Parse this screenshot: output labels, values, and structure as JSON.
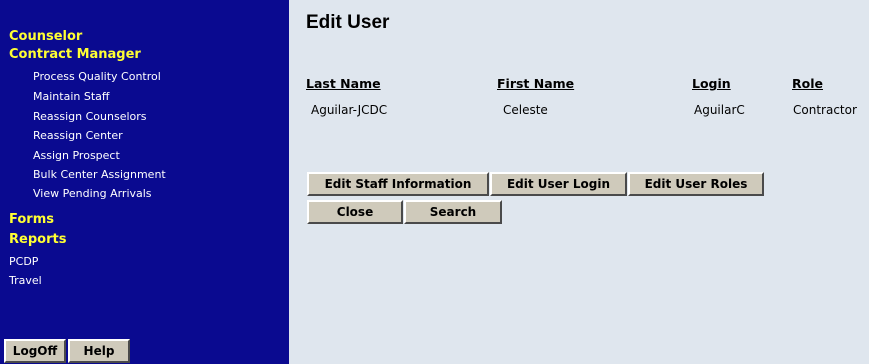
{
  "sidebar": {
    "sections": {
      "counselor": "Counselor",
      "contract_manager": "Contract Manager",
      "forms": "Forms",
      "reports": "Reports"
    },
    "contract_items": [
      "Process Quality Control",
      "Maintain Staff",
      "Reassign Counselors",
      "Reassign Center",
      "Assign Prospect",
      "Bulk Center Assignment",
      "View Pending Arrivals"
    ],
    "links": {
      "pcdp": "PCDP",
      "travel": "Travel"
    },
    "buttons": {
      "logoff": "LogOff",
      "help": "Help"
    }
  },
  "main": {
    "title": "Edit User",
    "columns": {
      "last_name": "Last Name",
      "first_name": "First Name",
      "login": "Login",
      "role": "Role"
    },
    "user": {
      "last_name": "Aguilar-JCDC",
      "first_name": "Celeste",
      "login": "AguilarC",
      "role": "Contractor"
    },
    "buttons": {
      "edit_staff": "Edit Staff Information",
      "edit_login": "Edit User Login",
      "edit_roles": "Edit User Roles",
      "close": "Close",
      "search": "Search"
    }
  },
  "colors": {
    "sidebar_bg": "#0a0a90",
    "section_text": "#ffff33",
    "page_bg": "#dfe6ee",
    "button_bg": "#cfcabb"
  }
}
